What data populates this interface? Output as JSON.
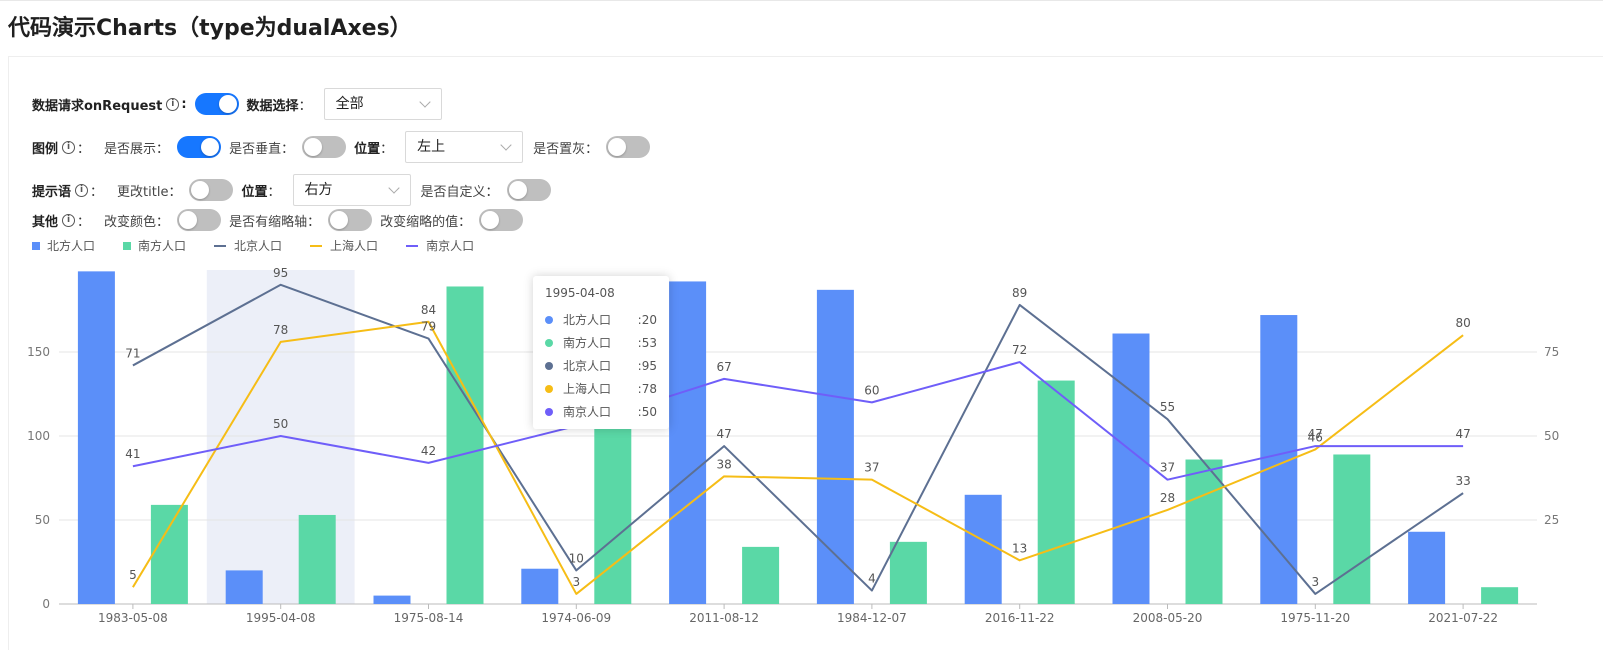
{
  "page": {
    "title": "代码演示Charts（type为dualAxes）"
  },
  "controls": {
    "row1": {
      "request_label": "数据请求onRequest",
      "request_on": true,
      "data_select_label": "数据选择",
      "data_select_value": "全部"
    },
    "row2": {
      "group_label": "图例",
      "show_label": "是否展示",
      "show_on": true,
      "vertical_label": "是否垂直",
      "vertical_on": false,
      "position_label": "位置",
      "position_value": "左上",
      "gray_label": "是否置灰",
      "gray_on": false
    },
    "row3": {
      "group_label": "提示语",
      "title_label": "更改title",
      "title_on": false,
      "position_label": "位置",
      "position_value": "右方",
      "custom_label": "是否自定义",
      "custom_on": false
    },
    "row4": {
      "group_label": "其他",
      "color_label": "改变颜色",
      "color_on": false,
      "slider_label": "是否有缩略轴",
      "slider_on": false,
      "slider_value_label": "改变缩略的值",
      "slider_value_on": false
    }
  },
  "chart_data": {
    "type": "bar",
    "categories": [
      "1983-05-08",
      "1995-04-08",
      "1975-08-14",
      "1974-06-09",
      "2011-08-12",
      "1984-12-07",
      "2016-11-22",
      "2008-05-20",
      "1975-11-20",
      "2021-07-22"
    ],
    "left_axis": {
      "ticks": [
        0,
        50,
        100,
        150
      ],
      "range": [
        0,
        200
      ]
    },
    "right_axis": {
      "ticks": [
        25,
        50,
        75
      ],
      "range": [
        0,
        100
      ]
    },
    "bar_series": [
      {
        "name": "北方人口",
        "color": "#5b8ff9",
        "values": [
          198,
          20,
          5,
          21,
          192,
          187,
          65,
          161,
          172,
          43
        ]
      },
      {
        "name": "南方人口",
        "color": "#5ad8a6",
        "values": [
          59,
          53,
          189,
          108,
          34,
          37,
          133,
          86,
          89,
          10
        ]
      }
    ],
    "line_series": [
      {
        "name": "北京人口",
        "color": "#5d7092",
        "values": [
          71,
          95,
          79,
          10,
          47,
          4,
          89,
          55,
          3,
          33
        ]
      },
      {
        "name": "上海人口",
        "color": "#f6bd16",
        "values": [
          5,
          78,
          84,
          3,
          38,
          37,
          13,
          28,
          46,
          80
        ]
      },
      {
        "name": "南京人口",
        "color": "#6f5ef9",
        "values": [
          41,
          50,
          42,
          53,
          67,
          60,
          72,
          37,
          47,
          47
        ]
      }
    ],
    "legend_position": "top-left",
    "grid": true,
    "highlight_category": "1995-04-08",
    "highlight_index": 1
  },
  "tooltip": {
    "title": "1995-04-08",
    "rows": [
      {
        "name": "北方人口",
        "value": "20",
        "color": "#5b8ff9"
      },
      {
        "name": "南方人口",
        "value": "53",
        "color": "#5ad8a6"
      },
      {
        "name": "北京人口",
        "value": "95",
        "color": "#5d7092"
      },
      {
        "name": "上海人口",
        "value": "78",
        "color": "#f6bd16"
      },
      {
        "name": "南京人口",
        "value": "50",
        "color": "#6f5ef9"
      }
    ]
  }
}
